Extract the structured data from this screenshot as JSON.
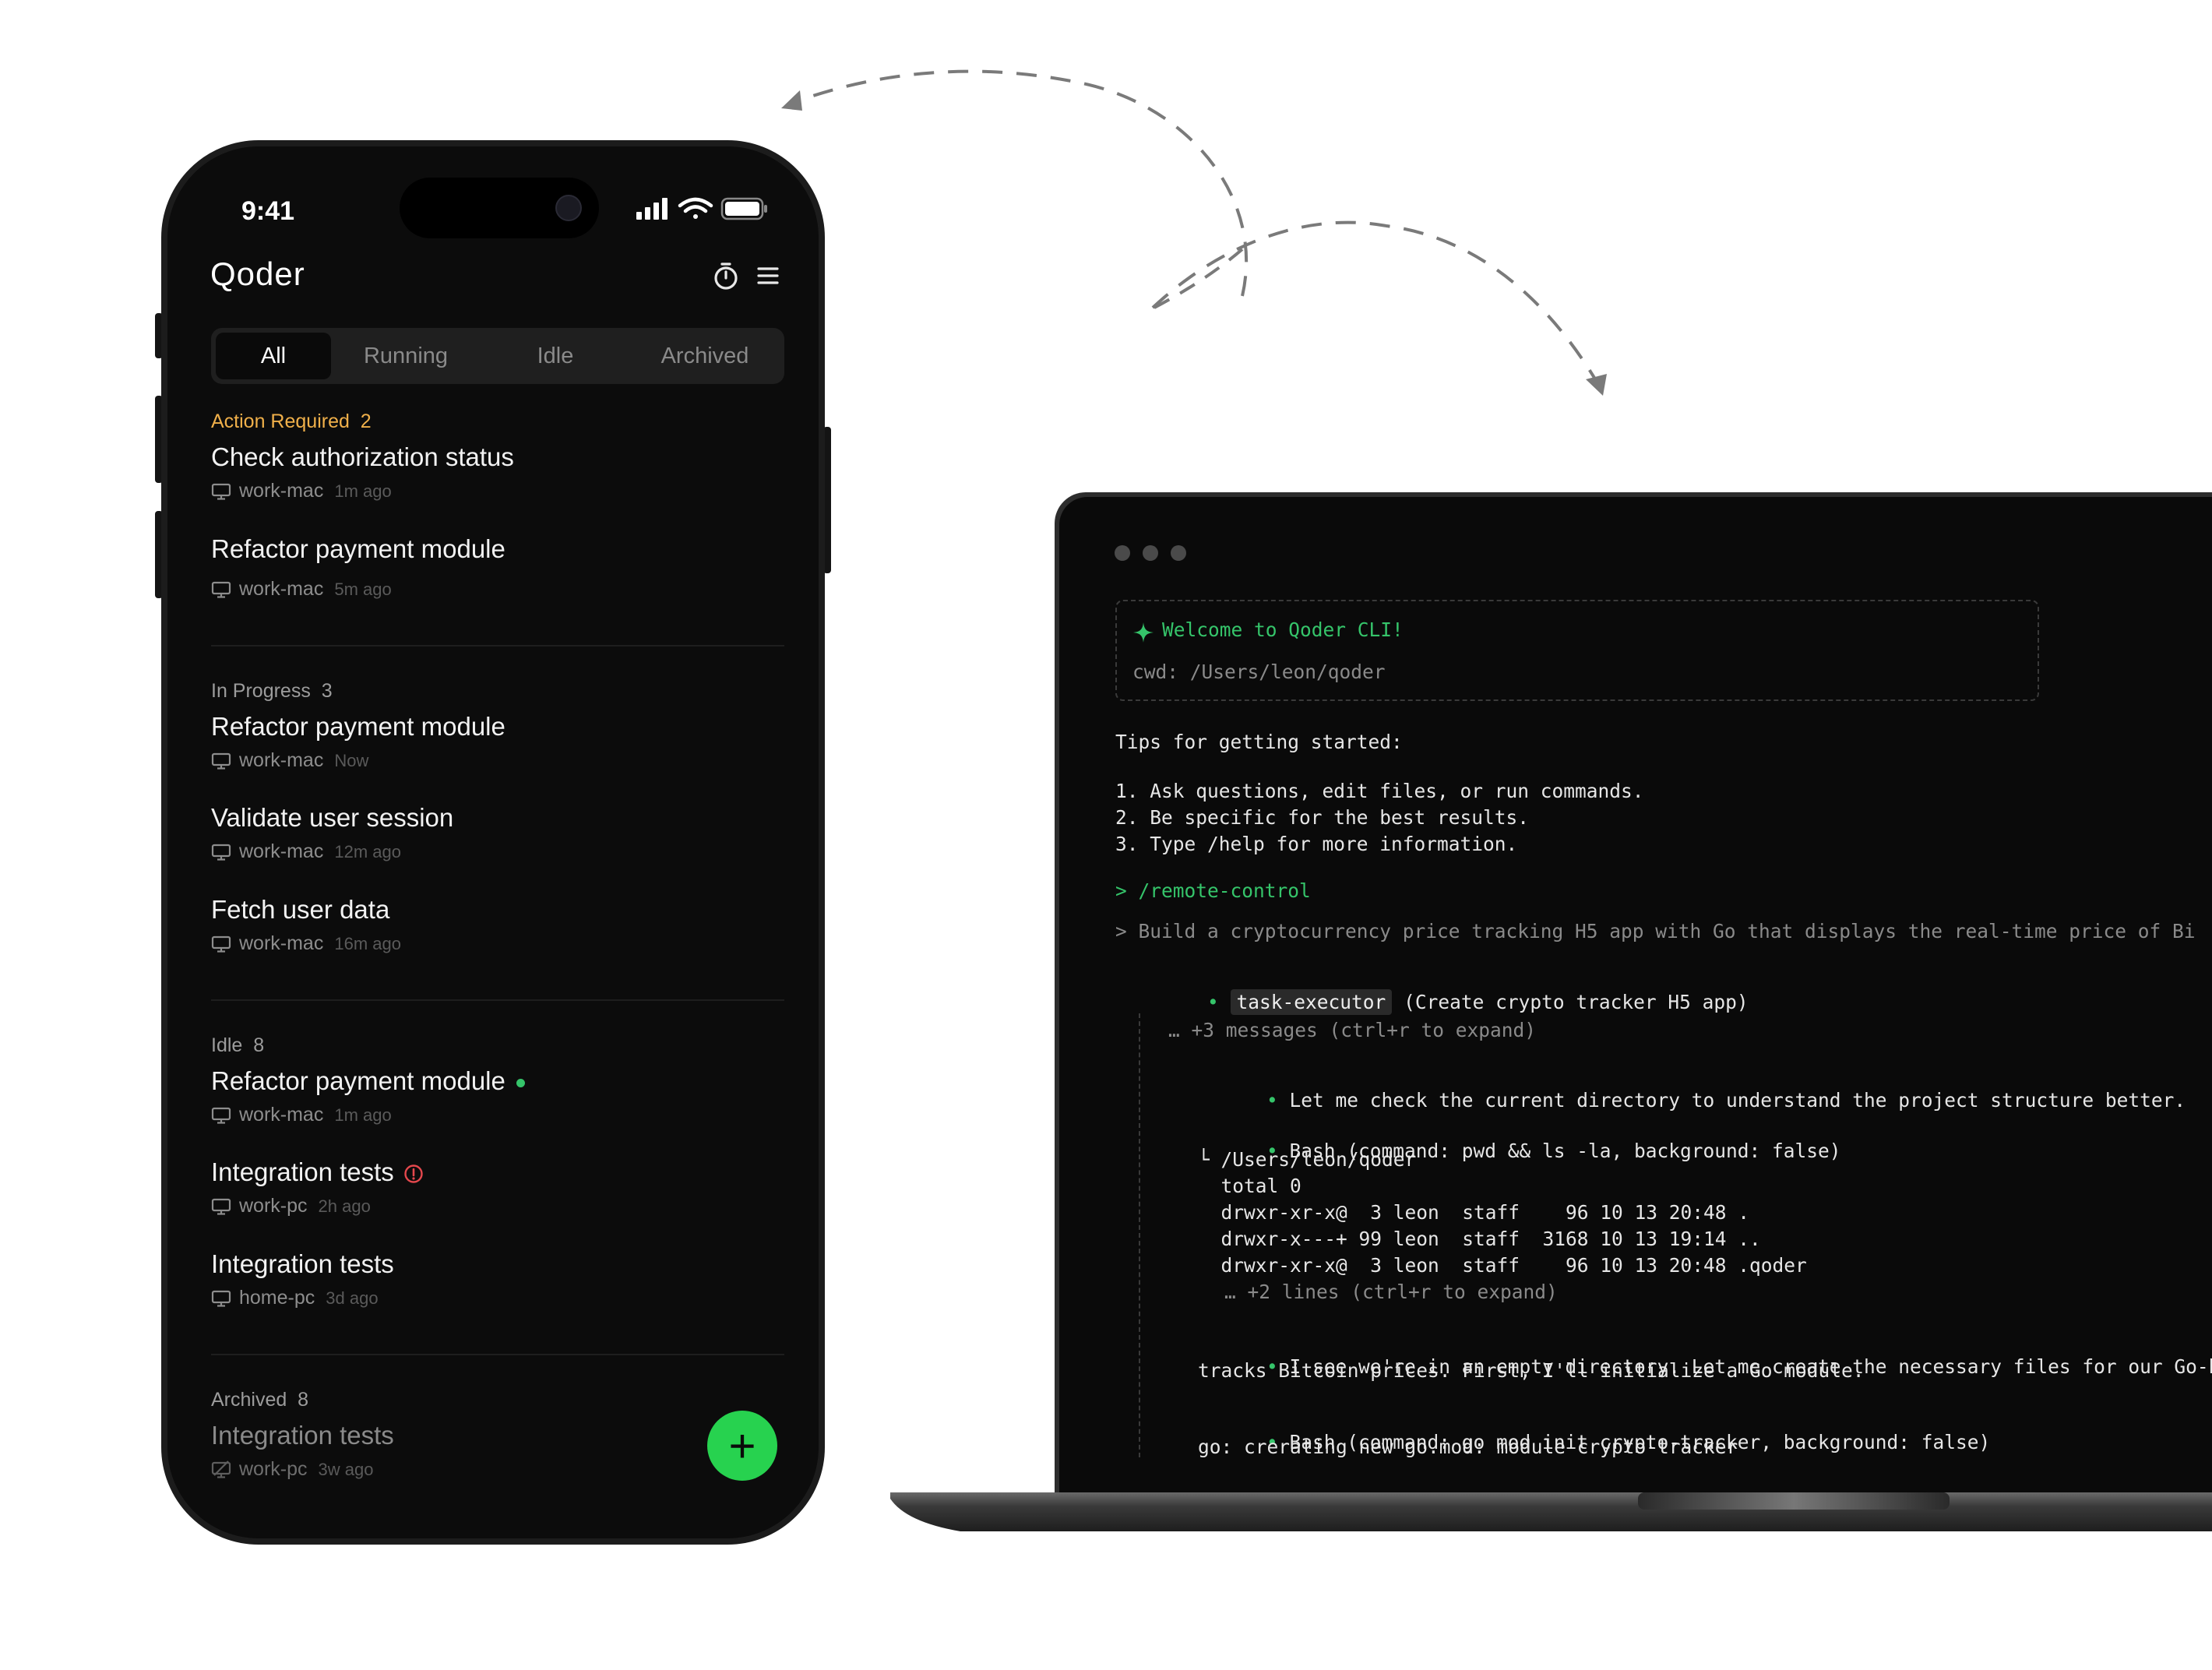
{
  "phone": {
    "status": {
      "time": "9:41"
    },
    "app_title": "Qoder",
    "header_icons": [
      "timer-icon",
      "menu-icon"
    ],
    "tabs": [
      {
        "label": "All",
        "active": true
      },
      {
        "label": "Running",
        "active": false
      },
      {
        "label": "Idle",
        "active": false
      },
      {
        "label": "Archived",
        "active": false
      }
    ],
    "sections": [
      {
        "label": "Action Required",
        "count": "2",
        "tasks": [
          {
            "title": "Check authorization status",
            "device": "work-mac",
            "ago": "1m ago"
          },
          {
            "title": "Refactor payment module",
            "device": "work-mac",
            "ago": "5m ago"
          }
        ]
      },
      {
        "label": "In Progress",
        "count": "3",
        "tasks": [
          {
            "title": "Refactor payment module",
            "device": "work-mac",
            "ago": "Now"
          },
          {
            "title": "Validate user session",
            "device": "work-mac",
            "ago": "12m ago"
          },
          {
            "title": "Fetch user data",
            "device": "work-mac",
            "ago": "16m ago"
          }
        ]
      },
      {
        "label": "Idle",
        "count": "8",
        "tasks": [
          {
            "title": "Refactor payment module",
            "device": "work-mac",
            "ago": "1m ago",
            "status": "green-dot"
          },
          {
            "title": "Integration tests",
            "device": "work-pc",
            "ago": "2h ago",
            "status": "error"
          },
          {
            "title": "Integration tests",
            "device": "home-pc",
            "ago": "3d ago"
          }
        ]
      },
      {
        "label": "Archived",
        "count": "8",
        "tasks": [
          {
            "title": "Integration tests",
            "device": "work-pc",
            "ago": "3w ago"
          }
        ]
      }
    ],
    "fab_label": "+"
  },
  "terminal": {
    "welcome": "Welcome to Qoder CLI!",
    "cwd": "cwd: /Users/leon/qoder",
    "tips_heading": "Tips for getting started:",
    "tips": [
      "1. Ask questions, edit files, or run commands.",
      "2. Be specific for the best results.",
      "3. Type /help for more information."
    ],
    "command": "> /remote-control",
    "prompt": "> Build a cryptocurrency price tracking H5 app with Go that displays the real-time price of Bi",
    "agent_name": "task-executor",
    "agent_desc": "(Create crypto tracker H5 app)",
    "collapsed_messages": "… +3 messages (ctrl+r to expand)",
    "step1": "Let me check the current directory to understand the project structure better.",
    "bash1": "Bash (command: pwd && ls -la, background: false)",
    "bash1_output": [
      "└ /Users/leon/qoder",
      "  total 0",
      "  drwxr-xr-x@  3 leon  staff    96 10 13 20:48 .",
      "  drwxr-x---+ 99 leon  staff  3168 10 13 19:14 ..",
      "  drwxr-xr-x@  3 leon  staff    96 10 13 20:48 .qoder"
    ],
    "bash1_more": "… +2 lines (ctrl+r to expand)",
    "step2_line1": "I see we're in an empty directory. Let me create the necessary files for our Go-based H",
    "step2_line2": "tracks Bitcoin prices. First, I'll initialize a Go module.",
    "bash2": "Bash (command: go mod init crypto-tracker, background: false)",
    "bash2_output": "go: crerating new go.mod: module crypto-tracker"
  },
  "colors": {
    "accent_green": "#35c46a",
    "fab_green": "#27d24f",
    "warn_amber": "#f0b04a",
    "error_red": "#e5484d"
  }
}
